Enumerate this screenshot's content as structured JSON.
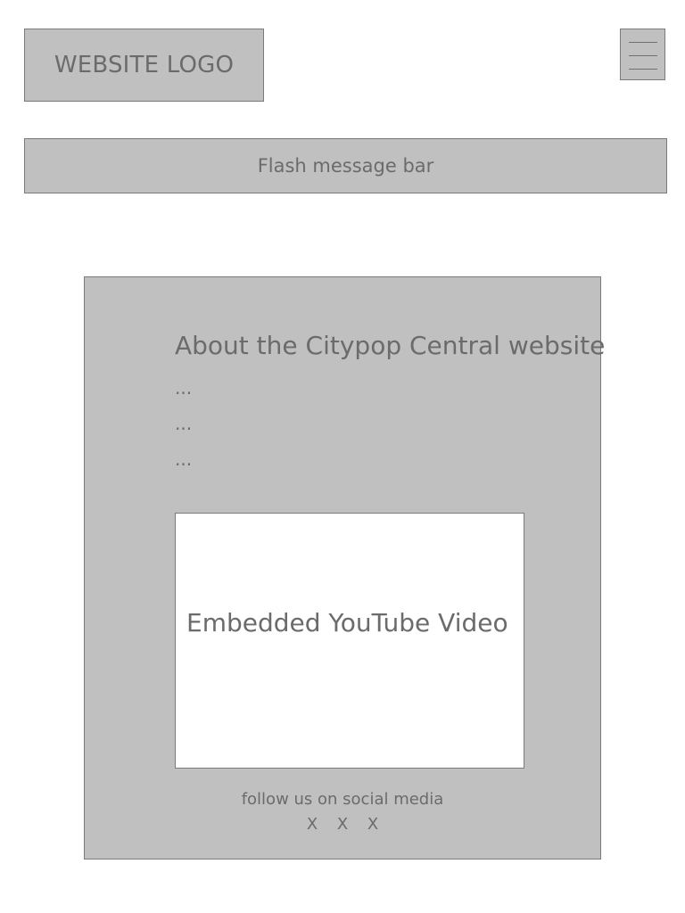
{
  "header": {
    "logo_text": "WEBSITE LOGO"
  },
  "flash": {
    "message": "Flash message bar"
  },
  "about": {
    "title": "About the Citypop Central website",
    "lines": [
      "...",
      "...",
      "..."
    ]
  },
  "video": {
    "label": "Embedded YouTube Video"
  },
  "social": {
    "label": "follow us on social media",
    "icons": [
      "X",
      "X",
      "X"
    ]
  }
}
